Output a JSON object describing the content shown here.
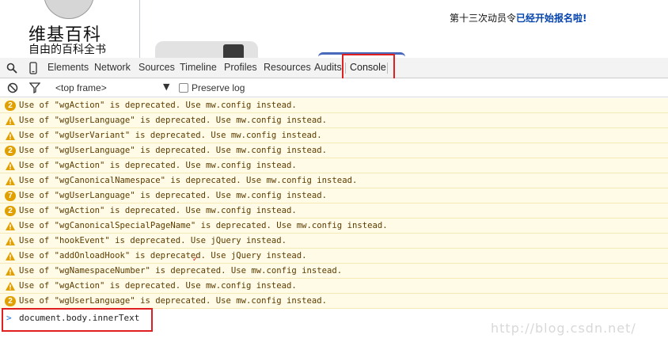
{
  "wiki": {
    "logo_title": "维基百科",
    "logo_subtitle": "自由的百科全书",
    "notice_prefix": "第十三次动员令",
    "notice_link": "已经开始报名啦",
    "notice_suffix": "!"
  },
  "devtools": {
    "tabs": [
      "Elements",
      "Network",
      "Sources",
      "Timeline",
      "Profiles",
      "Resources",
      "Audits",
      "Console"
    ],
    "active_tab": "Console",
    "frame_selector": "<top frame>",
    "preserve_log_label": "Preserve log",
    "preserve_log_checked": false
  },
  "console": {
    "messages": [
      {
        "icon": "count",
        "count": "2",
        "text": "Use of \"wgAction\" is deprecated. Use mw.config instead."
      },
      {
        "icon": "warning",
        "count": "",
        "text": "Use of \"wgUserLanguage\" is deprecated. Use mw.config instead."
      },
      {
        "icon": "warning",
        "count": "",
        "text": "Use of \"wgUserVariant\" is deprecated. Use mw.config instead."
      },
      {
        "icon": "count",
        "count": "2",
        "text": "Use of \"wgUserLanguage\" is deprecated. Use mw.config instead."
      },
      {
        "icon": "warning",
        "count": "",
        "text": "Use of \"wgAction\" is deprecated. Use mw.config instead."
      },
      {
        "icon": "warning",
        "count": "",
        "text": "Use of \"wgCanonicalNamespace\" is deprecated. Use mw.config instead."
      },
      {
        "icon": "count",
        "count": "7",
        "text": "Use of \"wgUserLanguage\" is deprecated. Use mw.config instead."
      },
      {
        "icon": "count",
        "count": "2",
        "text": "Use of \"wgAction\" is deprecated. Use mw.config instead."
      },
      {
        "icon": "warning",
        "count": "",
        "text": "Use of \"wgCanonicalSpecialPageName\" is deprecated. Use mw.config instead."
      },
      {
        "icon": "warning",
        "count": "",
        "text": "Use of \"hookEvent\" is deprecated. Use jQuery instead."
      },
      {
        "icon": "warning",
        "count": "",
        "text": "Use of \"addOnloadHook\" is deprecated. Use jQuery instead."
      },
      {
        "icon": "warning",
        "count": "",
        "text": "Use of \"wgNamespaceNumber\" is deprecated. Use mw.config instead."
      },
      {
        "icon": "warning",
        "count": "",
        "text": "Use of \"wgAction\" is deprecated. Use mw.config instead."
      },
      {
        "icon": "count",
        "count": "2",
        "text": "Use of \"wgUserLanguage\" is deprecated. Use mw.config instead."
      }
    ],
    "prompt_symbol": ">",
    "command": "document.body.innerText"
  },
  "watermark": "http://blog.csdn.net/",
  "colors": {
    "highlight": "#e02020",
    "warning_bg": "#fffbe6",
    "badge": "#e0a000",
    "link": "#0645ad"
  }
}
